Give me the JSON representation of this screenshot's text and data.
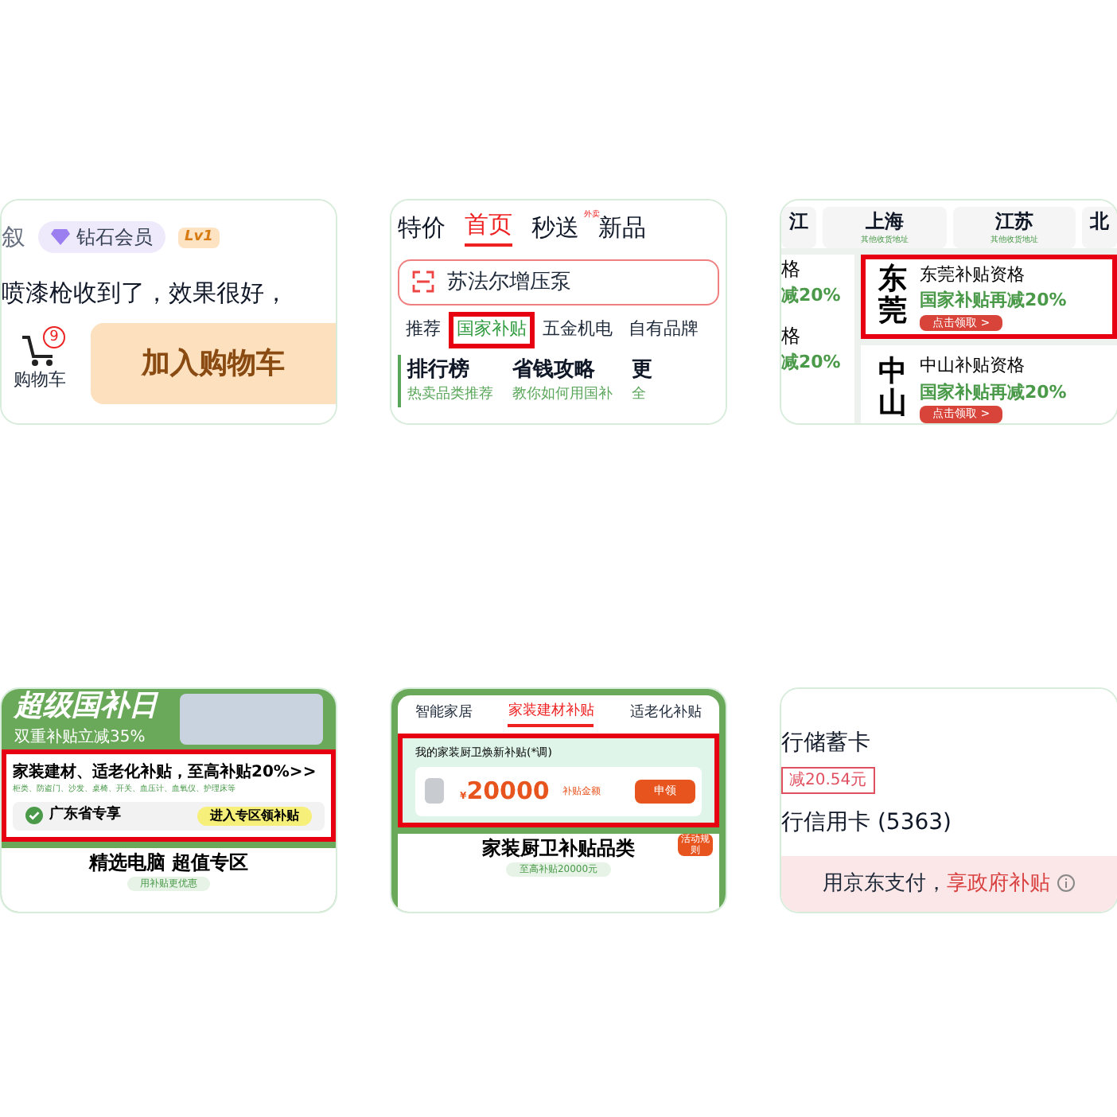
{
  "panels": [
    {
      "kind": "product",
      "user_name": "叙",
      "member_badge": "钻石会员",
      "level_badge": "Lv1",
      "review": "喷漆枪收到了，效果很好，",
      "cart": {
        "label": "购物车",
        "count": "9"
      },
      "add_button": "加入购物车"
    },
    {
      "kind": "home",
      "top_tabs": [
        {
          "label": "特价",
          "selected": false
        },
        {
          "label": "首页",
          "selected": true
        },
        {
          "label": "秒送",
          "selected": false,
          "tag": "外卖"
        },
        {
          "label": "新品",
          "selected": false
        }
      ],
      "search": {
        "value": "苏法尔增压泵"
      },
      "categories": [
        {
          "label": "推荐",
          "selected": false,
          "highlighted": false
        },
        {
          "label": "国家补贴",
          "selected": true,
          "highlighted": true
        },
        {
          "label": "五金机电",
          "selected": false,
          "highlighted": false
        },
        {
          "label": "自有品牌",
          "selected": false,
          "highlighted": false
        }
      ],
      "cards": [
        {
          "title": "排行榜",
          "subtitle": "热卖品类推荐"
        },
        {
          "title": "省钱攻略",
          "subtitle": "教你如何用国补"
        },
        {
          "title": "更",
          "subtitle": "全"
        }
      ]
    },
    {
      "kind": "regions",
      "cities": [
        {
          "name": "江"
        },
        {
          "name": "上海",
          "note": "其他收货地址"
        },
        {
          "name": "江苏",
          "note": "其他收货地址"
        },
        {
          "name": "北"
        }
      ],
      "left_rows": [
        {
          "title": "格",
          "offer": "减20%"
        },
        {
          "title": "格",
          "offer": "减20%"
        }
      ],
      "regions": [
        {
          "city": "东莞",
          "title": "东莞补贴资格",
          "offer": "国家补贴再减20%",
          "button": "点击领取 >",
          "highlighted": true
        },
        {
          "city": "中山",
          "title": "中山补贴资格",
          "offer": "国家补贴再减20%",
          "button": "点击领取 >",
          "highlighted": false
        }
      ]
    },
    {
      "kind": "promo",
      "banner_title": "超级国补日",
      "banner_subtitle": "双重补贴立减35%",
      "offer": {
        "title": "家装建材、适老化补贴，至高补贴20%>>",
        "items": "柜类、防盗门、沙发、桌椅、开关、血压计、血氧仪、护理床等",
        "region": "广东省专享",
        "button": "进入专区领补贴",
        "highlighted": true
      },
      "section_title": "精选电脑 超值专区",
      "section_tag": "用补贴更优惠"
    },
    {
      "kind": "subsidy",
      "tabs": [
        {
          "label": "智能家居",
          "selected": false
        },
        {
          "label": "家装建材补贴",
          "selected": true
        },
        {
          "label": "适老化补贴",
          "selected": false
        }
      ],
      "card": {
        "title": "我的家装厨卫焕新补贴(*调)",
        "currency": "¥",
        "amount": "20000",
        "amount_label": "补贴金额",
        "button": "申领",
        "highlighted": true
      },
      "section_title": "家装厨卫补贴品类",
      "section_tag": "至高补贴20000元",
      "rules_badge": "活动规则"
    },
    {
      "kind": "payment",
      "cards": [
        {
          "name": "行储蓄卡",
          "discount": "减20.54元"
        },
        {
          "name": "行信用卡 (5363)"
        }
      ],
      "banner": {
        "text": "用京东支付，",
        "highlight": "享政府补贴"
      }
    }
  ]
}
